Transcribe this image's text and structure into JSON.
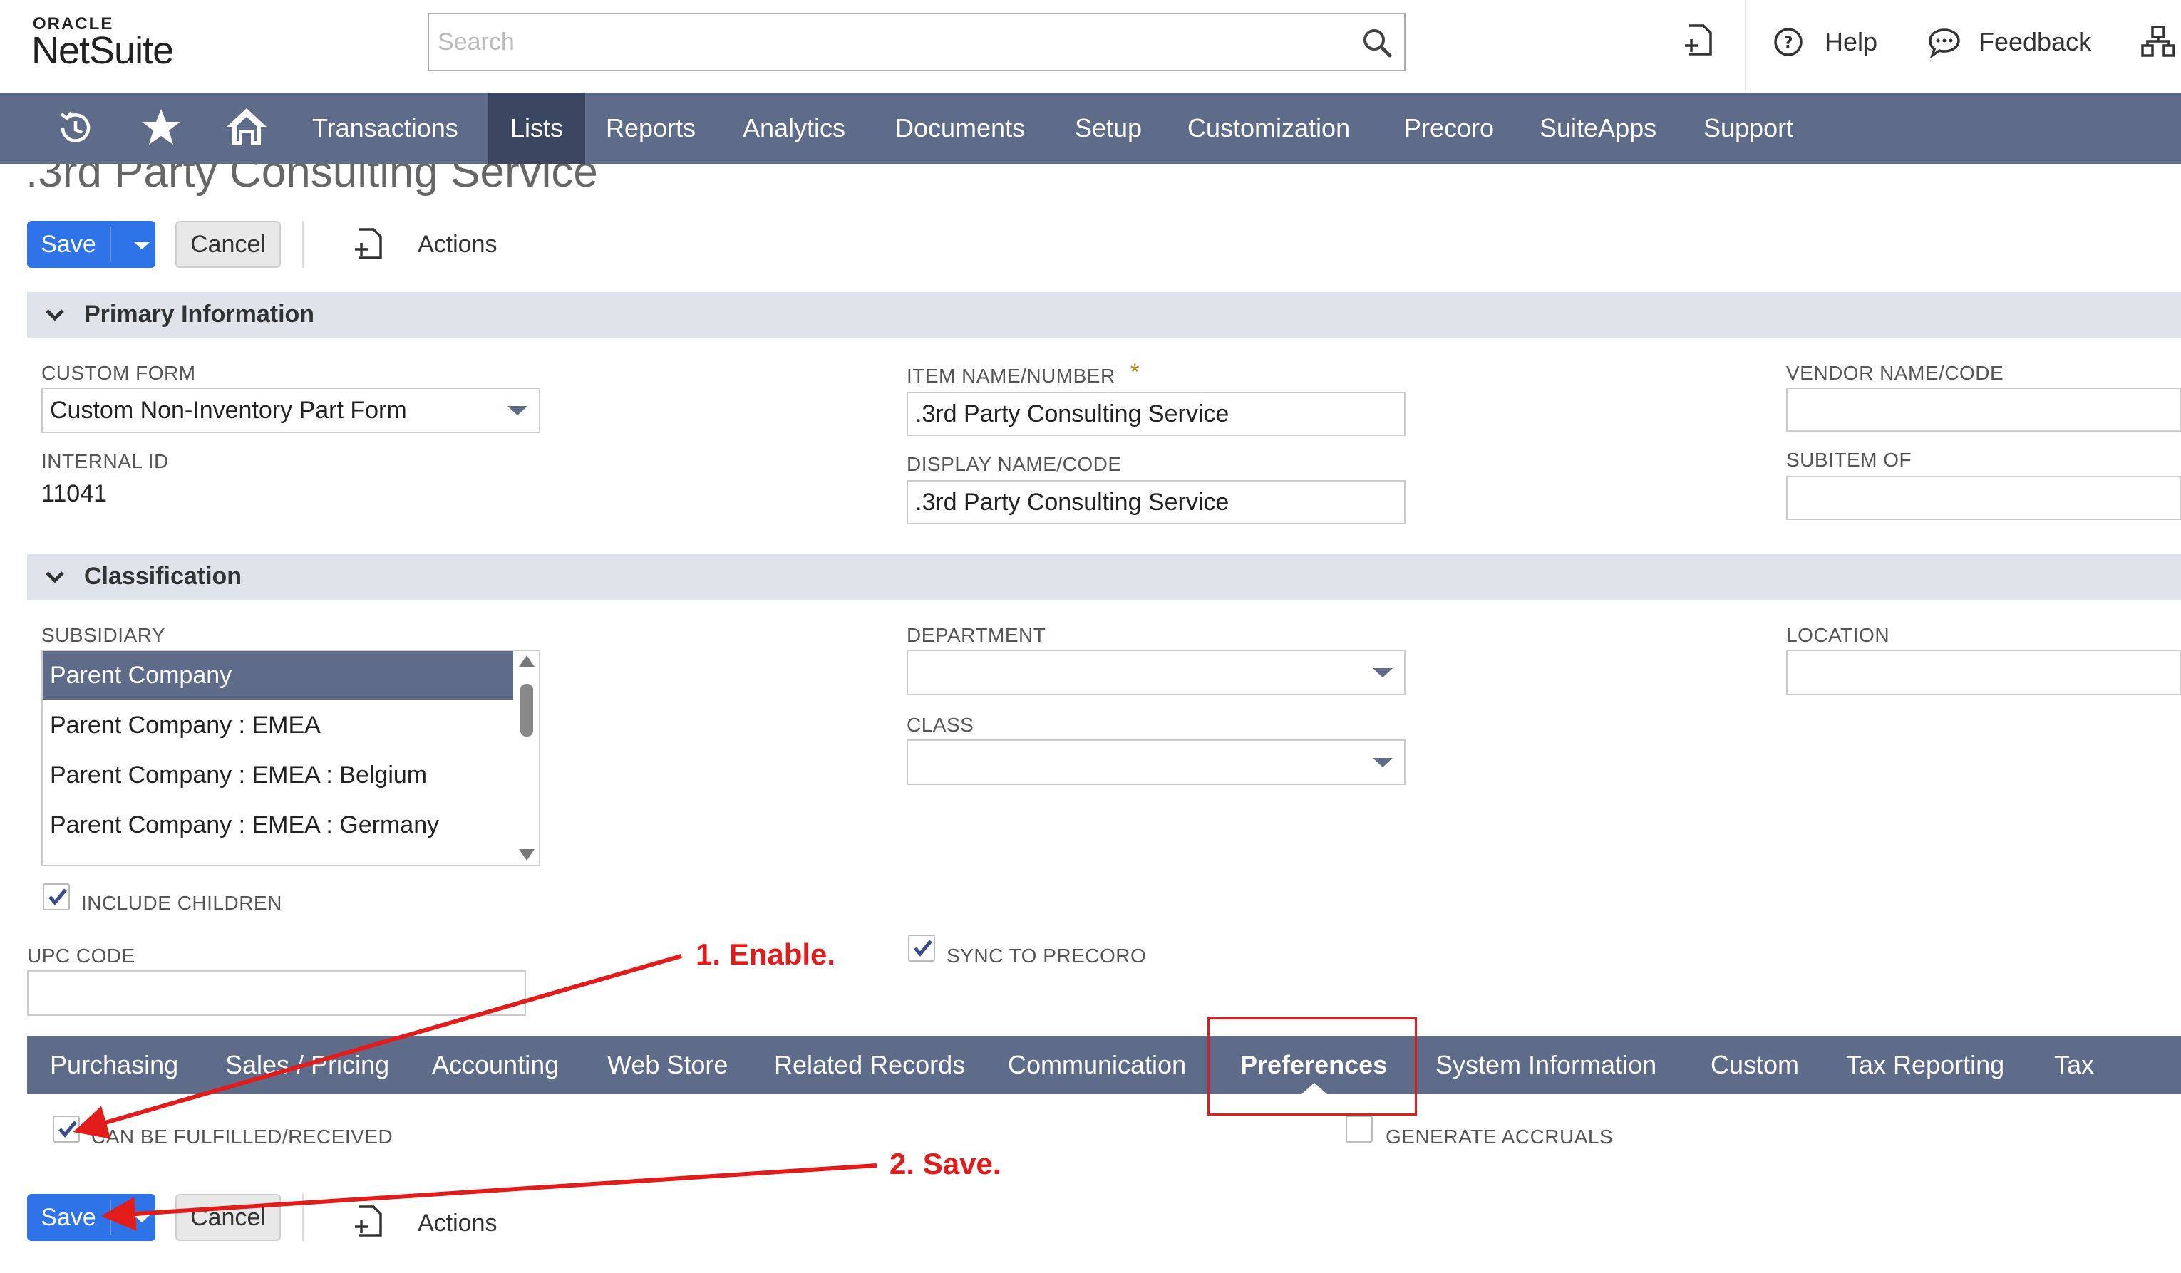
{
  "header": {
    "logo_top": "ORACLE",
    "logo_main": "NetSuite",
    "search_placeholder": "Search",
    "help_label": "Help",
    "feedback_label": "Feedback"
  },
  "nav": {
    "items": [
      "Transactions",
      "Lists",
      "Reports",
      "Analytics",
      "Documents",
      "Setup",
      "Customization",
      "Precoro",
      "SuiteApps",
      "Support"
    ],
    "active": "Lists"
  },
  "page": {
    "title": ".3rd Party Consulting Service"
  },
  "toolbar": {
    "save_label": "Save",
    "cancel_label": "Cancel",
    "actions_label": "Actions"
  },
  "primary": {
    "section_title": "Primary Information",
    "custom_form_label": "CUSTOM FORM",
    "custom_form_value": "Custom Non-Inventory Part Form",
    "internal_id_label": "INTERNAL ID",
    "internal_id_value": "11041",
    "item_name_label": "ITEM NAME/NUMBER",
    "item_name_required": "*",
    "item_name_value": ".3rd Party Consulting Service",
    "display_name_label": "DISPLAY NAME/CODE",
    "display_name_value": ".3rd Party Consulting Service",
    "vendor_name_label": "VENDOR NAME/CODE",
    "subitem_of_label": "SUBITEM OF"
  },
  "classification": {
    "section_title": "Classification",
    "subsidiary_label": "SUBSIDIARY",
    "subsidiary_options": [
      "Parent Company",
      "Parent Company : EMEA",
      "Parent Company : EMEA : Belgium",
      "Parent Company : EMEA : Germany"
    ],
    "subsidiary_selected": "Parent Company",
    "include_children_label": "INCLUDE CHILDREN",
    "include_children_checked": true,
    "department_label": "DEPARTMENT",
    "class_label": "CLASS",
    "location_label": "LOCATION",
    "upc_label": "UPC CODE",
    "sync_label": "SYNC TO PRECORO",
    "sync_checked": true
  },
  "tabs": {
    "items": [
      "Purchasing",
      "Sales / Pricing",
      "Accounting",
      "Web Store",
      "Related Records",
      "Communication",
      "Preferences",
      "System Information",
      "Custom",
      "Tax Reporting",
      "Tax"
    ],
    "active": "Preferences"
  },
  "preferences": {
    "can_be_fulfilled_label": "CAN BE FULFILLED/RECEIVED",
    "can_be_fulfilled_checked": true,
    "generate_accruals_label": "GENERATE ACCRUALS",
    "generate_accruals_checked": false
  },
  "annotations": {
    "step1": "1. Enable.",
    "step2": "2. Save.",
    "color": "#e21b1b"
  },
  "colors": {
    "nav_bg": "#5e6c8a",
    "nav_active_bg": "#3b4660",
    "save_blue": "#2f73e8",
    "section_bg": "#dfe3ea"
  }
}
